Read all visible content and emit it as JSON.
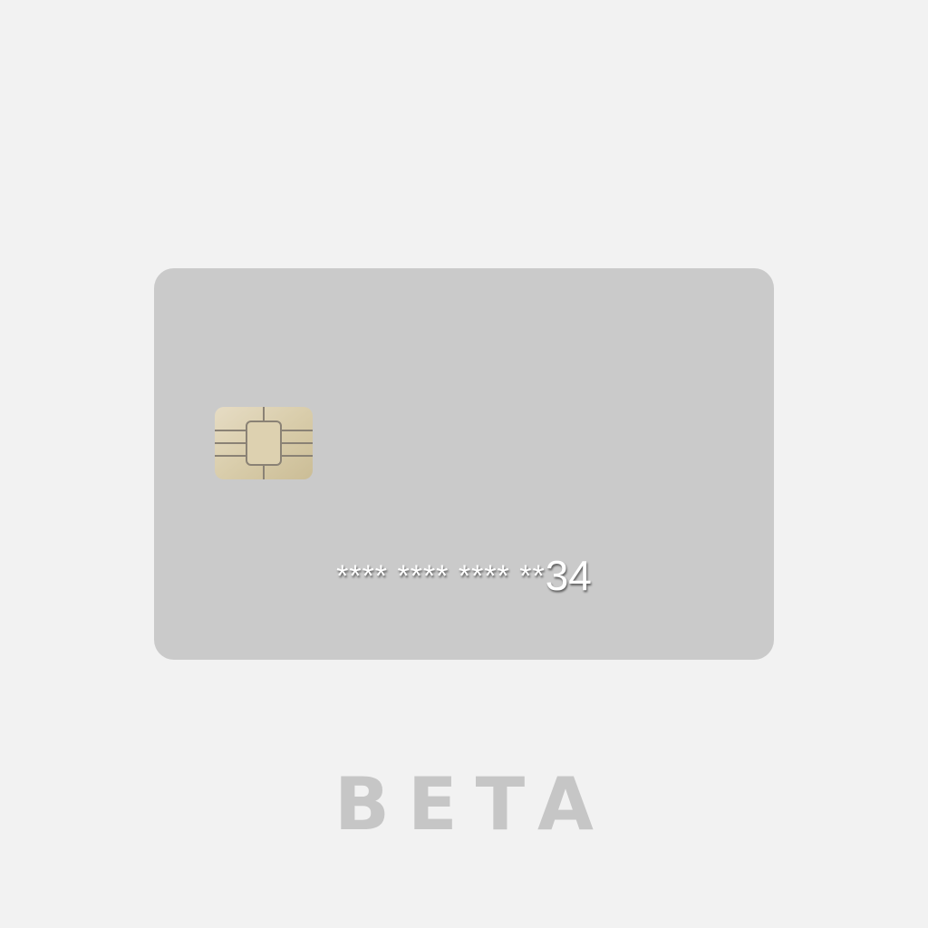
{
  "card": {
    "chip_icon": "emv-chip-icon",
    "number_masked": "**** **** **** **",
    "number_last_digits": "34"
  },
  "footer": {
    "label": "BETA"
  },
  "colors": {
    "background": "#f2f2f2",
    "card": "#cacaca",
    "chip_gold": "#d8cba8",
    "chip_lines": "#8a8275",
    "number_text": "#ffffff",
    "beta_text": "#c6c6c6"
  }
}
